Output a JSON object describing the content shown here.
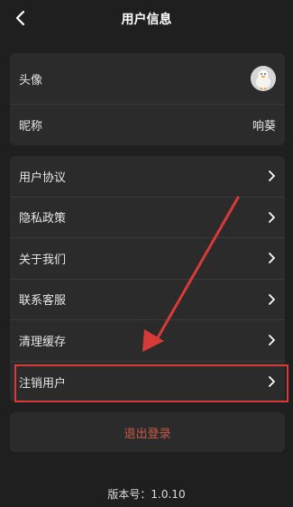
{
  "header": {
    "title": "用户信息",
    "back_icon": "chevron-left-icon"
  },
  "profile": {
    "avatar_label": "头像",
    "nickname_label": "昵称",
    "nickname_value": "响葵"
  },
  "menu": {
    "items": [
      {
        "label": "用户协议"
      },
      {
        "label": "隐私政策"
      },
      {
        "label": "关于我们"
      },
      {
        "label": "联系客服"
      },
      {
        "label": "清理缓存"
      },
      {
        "label": "注销用户"
      }
    ]
  },
  "logout": {
    "label": "退出登录"
  },
  "footer": {
    "version": "版本号：1.0.10"
  },
  "colors": {
    "background": "#1f1f1f",
    "card": "#2b2b2b",
    "annotation_red": "#d83a3a",
    "logout_text": "#c85a4a"
  }
}
